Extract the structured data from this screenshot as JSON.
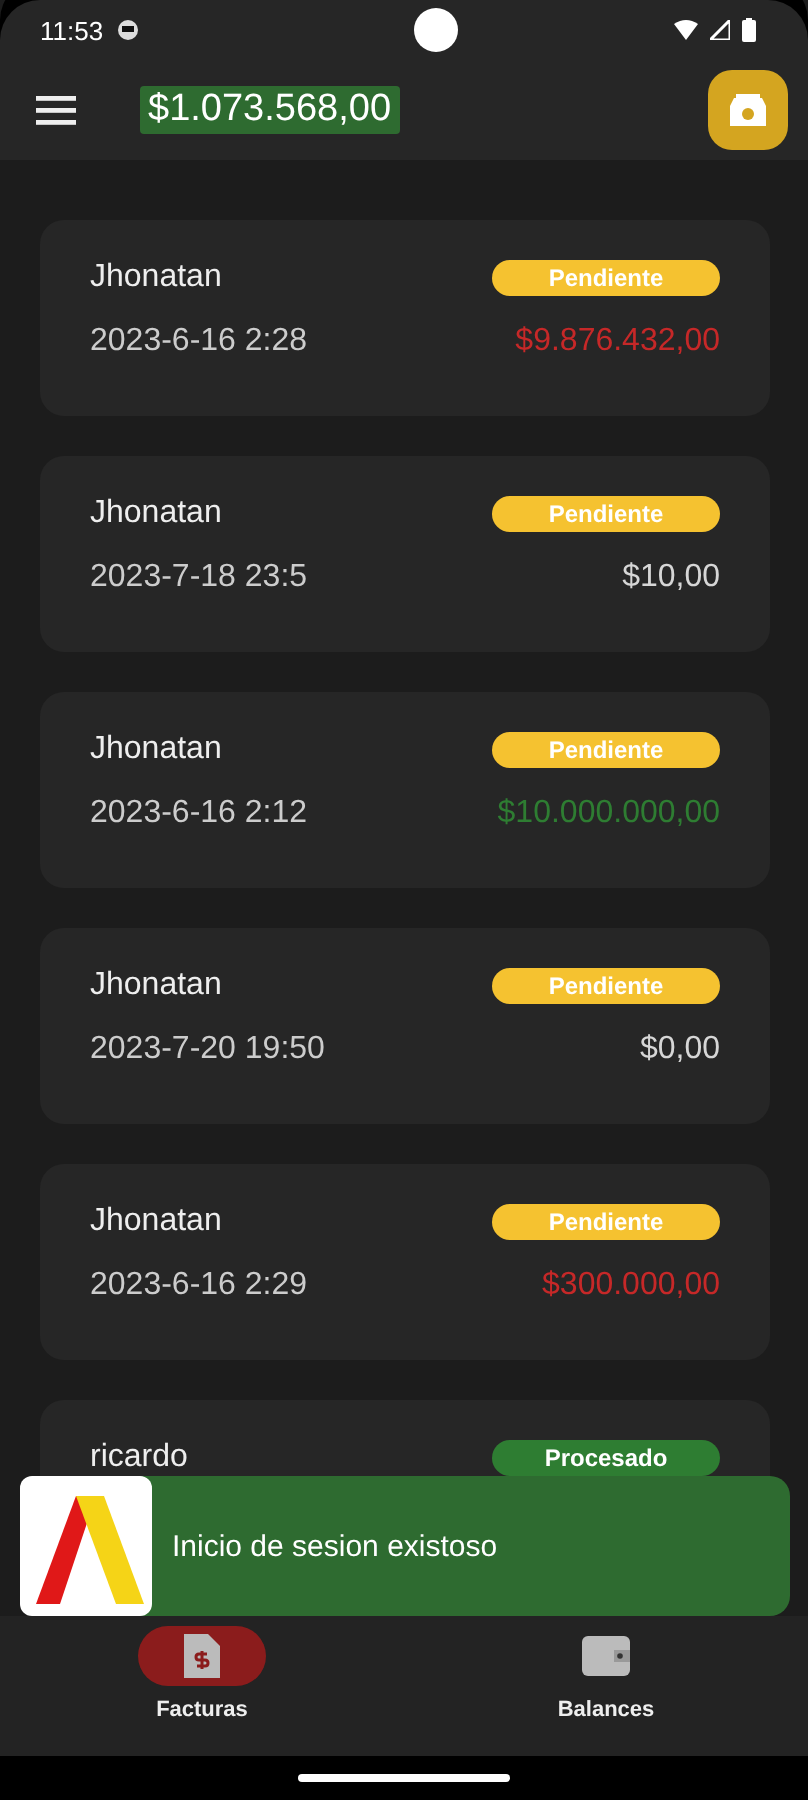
{
  "status_bar": {
    "time": "11:53"
  },
  "app_bar": {
    "balance": "$1.073.568,00"
  },
  "invoices": [
    {
      "name": "Jhonatan",
      "date": "2023-6-16 2:28",
      "amount": "$9.876.432,00",
      "color": "#c62828",
      "status": {
        "label": "Pendiente",
        "kind": "pending"
      }
    },
    {
      "name": "Jhonatan",
      "date": "2023-7-18 23:5",
      "amount": "$10,00",
      "color": "#d6d6d6",
      "status": {
        "label": "Pendiente",
        "kind": "pending"
      }
    },
    {
      "name": "Jhonatan",
      "date": "2023-6-16 2:12",
      "amount": "$10.000.000,00",
      "color": "#2e7d32",
      "status": {
        "label": "Pendiente",
        "kind": "pending"
      }
    },
    {
      "name": "Jhonatan",
      "date": "2023-7-20 19:50",
      "amount": "$0,00",
      "color": "#d6d6d6",
      "status": {
        "label": "Pendiente",
        "kind": "pending"
      }
    },
    {
      "name": "Jhonatan",
      "date": "2023-6-16 2:29",
      "amount": "$300.000,00",
      "color": "#c62828",
      "status": {
        "label": "Pendiente",
        "kind": "pending"
      }
    },
    {
      "name": "ricardo",
      "status": {
        "label": "Procesado",
        "kind": "processed"
      }
    }
  ],
  "toast": {
    "message": "Inicio de sesion existoso"
  },
  "bottom_nav": [
    {
      "label": "Facturas",
      "kind": "invoice",
      "selected": true
    },
    {
      "label": "Balances",
      "kind": "wallet",
      "selected": false
    }
  ]
}
